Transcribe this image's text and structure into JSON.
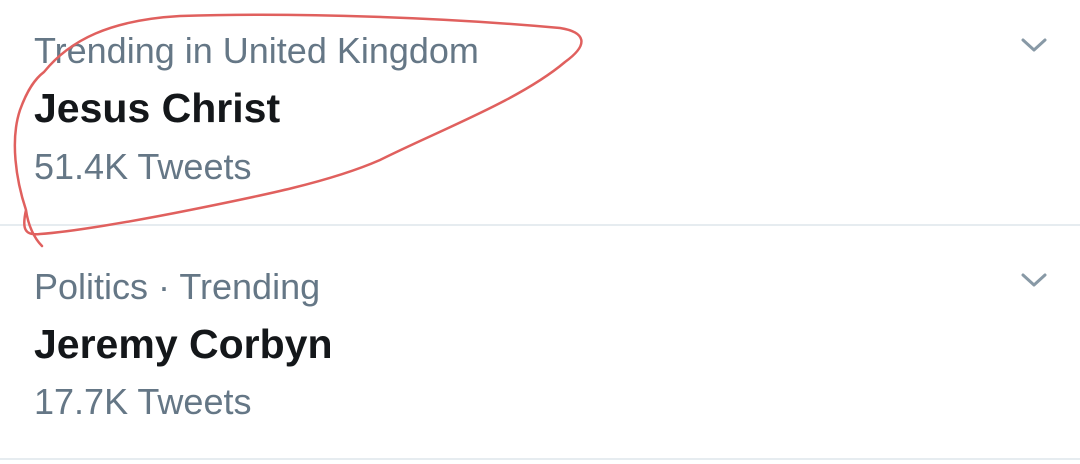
{
  "trends": [
    {
      "context": "Trending in United Kingdom",
      "name": "Jesus Christ",
      "tweet_count": "51.4K Tweets",
      "menu_icon": "chevron-down-icon"
    },
    {
      "context": "Politics · Trending",
      "name": "Jeremy Corbyn",
      "tweet_count": "17.7K Tweets",
      "menu_icon": "chevron-down-icon"
    }
  ],
  "colors": {
    "secondary_text": "#657786",
    "primary_text": "#14171a",
    "divider": "#e6ecf0",
    "annotation": "#e0605e"
  }
}
